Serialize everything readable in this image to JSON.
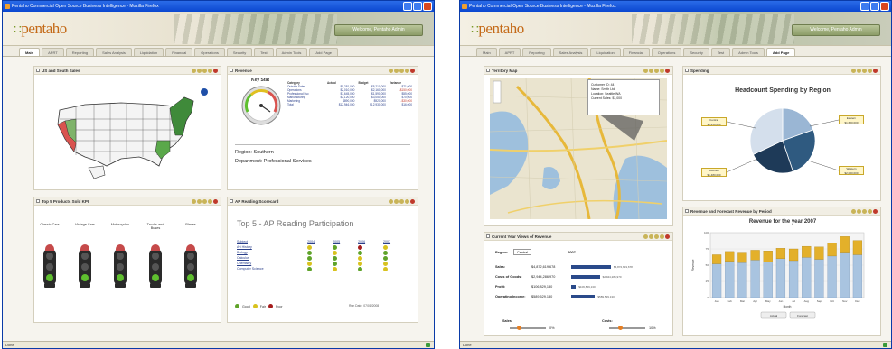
{
  "window_title": "Pentaho Commercial Open Source Business Intelligence - Mozilla Firefox",
  "logo_text": "pentaho",
  "header_button": "Welcome, Pentaho Admin",
  "status_text": "Done",
  "colors": {
    "titlebar": "#0b47d0",
    "logo": "#c46a18",
    "accent_green": "#5fbf2f",
    "accent_red": "#a51c1c",
    "accent_yellow": "#d8c21e"
  },
  "window1": {
    "tabs": [
      "Main",
      "APRT",
      "Reporting",
      "Sales Analysis",
      "Liquidation",
      "Financial",
      "Operations",
      "Security",
      "Test",
      "Admin Tools",
      "Add Page"
    ],
    "active_tab": 0,
    "panels": {
      "map": {
        "title": "US and South Sales"
      },
      "gauge": {
        "title": "Revenue",
        "gauge_label": "Key Stat",
        "table_headers": [
          "Category",
          "Actual",
          "Budget",
          "Variance"
        ],
        "table_rows": [
          [
            "Outside Sales",
            "$5,281,000",
            "$5,210,000",
            "$71,000"
          ],
          [
            "Operations",
            "$2,010,000",
            "$2,160,000",
            "-$150,000"
          ],
          [
            "Professional Svc",
            "$1,645,000",
            "$1,590,000",
            "$55,000"
          ],
          [
            "Manufacturing",
            "$3,120,000",
            "$3,050,000",
            "$70,000"
          ],
          [
            "Marketing",
            "$890,000",
            "$920,000",
            "-$30,000"
          ],
          [
            "Total",
            "$12,946,000",
            "$12,930,000",
            "$16,000"
          ]
        ],
        "region_line": "Region: Southern",
        "department_line": "Department: Professional Services"
      },
      "traffic": {
        "title": "Top 5 Products Sold KPI",
        "headers": [
          "Classic Cars",
          "Vintage Cars",
          "Motorcycles",
          "Trucks and Buses",
          "Planes"
        ],
        "green_lamp": [
          2,
          2,
          2,
          2,
          2
        ]
      },
      "ap": {
        "title_bar": "AP Reading Scorecard",
        "heading": "Top 5 - AP Reading Participation",
        "headers": [
          "Subject",
          "2004",
          "2005",
          "2006",
          "2007"
        ],
        "rows": [
          {
            "subject": "Art History",
            "marks": [
              "y",
              "g",
              "r",
              "y"
            ]
          },
          {
            "subject": "Biology",
            "marks": [
              "g",
              "y",
              "g",
              "g"
            ]
          },
          {
            "subject": "Calculus",
            "marks": [
              "g",
              "g",
              "y",
              "g"
            ]
          },
          {
            "subject": "Chemistry",
            "marks": [
              "y",
              "g",
              "y",
              "y"
            ]
          },
          {
            "subject": "Computer Science",
            "marks": [
              "g",
              "y",
              "g",
              "y"
            ]
          }
        ],
        "legend": [
          "Good",
          "Fair",
          "Poor"
        ],
        "footer": "Run Date: 07/01/2008"
      }
    }
  },
  "window2": {
    "tabs": [
      "Main",
      "APRT",
      "Reporting",
      "Sales Analysis",
      "Liquidation",
      "Financial",
      "Operations",
      "Security",
      "Test",
      "Admin Tools",
      "Add Page"
    ],
    "active_tab": 10,
    "panels": {
      "map": {
        "title": "Territory Map",
        "bubble": [
          "Customer ID: 44",
          "Name: Smith Ltd.",
          "Location: Seattle WA",
          "Current Sales: $1,000"
        ]
      },
      "pie": {
        "title_bar": "Spending",
        "heading": "Headcount Spending by Region",
        "labels": [
          "Central\n$1,250,000",
          "Eastern\n$1,620,000",
          "Southern\n$1,480,000",
          "Western\n$2,050,000"
        ]
      },
      "finance": {
        "title": "Current Year Views of Revenue",
        "region_label": "Region:",
        "region_value": "Central",
        "year_value": "2007",
        "rows": [
          {
            "label": "Sales:",
            "value": "$4,872,619,678",
            "bar": 1.0,
            "note": "$4,872,619,678"
          },
          {
            "label": "Costs of Goods:",
            "value": "$2,944,286,970",
            "bar": 0.72,
            "note": "$2,944,286,970"
          },
          {
            "label": "Profit:",
            "value": "$106,829,130",
            "bar": 0.12,
            "note": "$106,829,130"
          },
          {
            "label": "Operating Income:",
            "value": "$589,529,130",
            "bar": 0.6,
            "note": "$589,529,130"
          }
        ],
        "sales_label": "Sales:",
        "sales_pct": "0%",
        "costs_label": "Costs:",
        "costs_pct": "10%"
      },
      "revenue": {
        "title": "Revenue and Forecast Revenue by Period",
        "heading": "Revenue for the year 2007"
      }
    }
  },
  "chart_data": [
    {
      "type": "pie",
      "title": "Headcount Spending by Region",
      "categories": [
        "Central",
        "Eastern",
        "Southern",
        "Western"
      ],
      "values": [
        1250000,
        1620000,
        1480000,
        2050000
      ]
    },
    {
      "type": "bar",
      "title": "Revenue for the year 2007",
      "xlabel": "Month",
      "ylabel": "Revenue",
      "categories": [
        "Jan",
        "Feb",
        "Mar",
        "Apr",
        "May",
        "Jun",
        "Jul",
        "Aug",
        "Sep",
        "Oct",
        "Nov",
        "Dec"
      ],
      "series": [
        {
          "name": "Actual",
          "values": [
            52,
            56,
            54,
            58,
            55,
            60,
            57,
            62,
            59,
            64,
            70,
            66
          ]
        },
        {
          "name": "Forecast",
          "values": [
            14,
            15,
            16,
            15,
            17,
            16,
            18,
            17,
            19,
            20,
            24,
            22
          ]
        }
      ],
      "ylim": [
        0,
        100
      ]
    }
  ]
}
